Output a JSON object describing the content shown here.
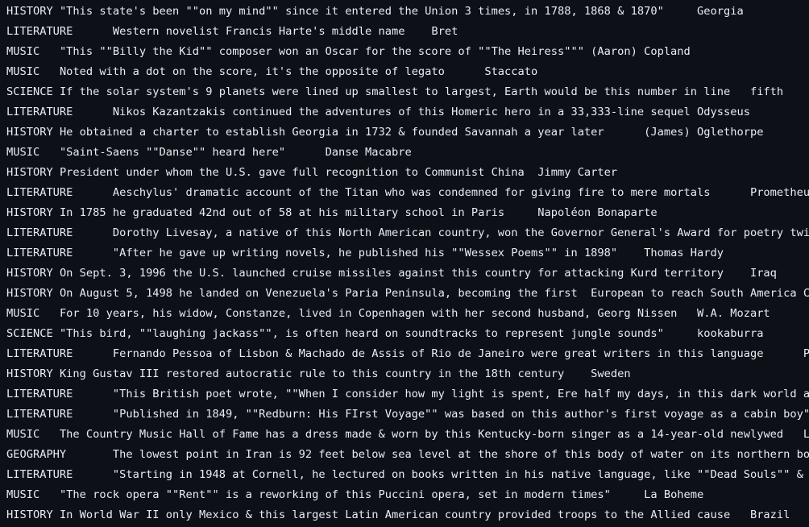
{
  "colors": {
    "background": "#0d1117",
    "text": "#e6edf3"
  },
  "rows": [
    {
      "category": "HISTORY",
      "question": "\"This state's been \"\"on my mind\"\" since it entered the Union 3 times, in 1788, 1868 & 1870\"",
      "answer": "Georgia"
    },
    {
      "category": "LITERATURE",
      "question": "Western novelist Francis Harte's middle name",
      "answer": "Bret"
    },
    {
      "category": "MUSIC",
      "question": "\"This \"\"Billy the Kid\"\" composer won an Oscar for the score of \"\"The Heiress\"\"\"",
      "answer": "(Aaron) Copland"
    },
    {
      "category": "MUSIC",
      "question": "Noted with a dot on the score, it's the opposite of legato",
      "answer": "Staccato"
    },
    {
      "category": "SCIENCE",
      "question": "If the solar system's 9 planets were lined up smallest to largest, Earth would be this number in line",
      "answer": "fifth"
    },
    {
      "category": "LITERATURE",
      "question": "Nikos Kazantzakis continued the adventures of this Homeric hero in a 33,333-line sequel",
      "answer": "Odysseus"
    },
    {
      "category": "HISTORY",
      "question": "He obtained a charter to establish Georgia in 1732 & founded Savannah a year later",
      "answer": "(James) Oglethorpe"
    },
    {
      "category": "MUSIC",
      "question": "\"Saint-Saens \"\"Danse\"\" heard here\"",
      "answer": "Danse Macabre"
    },
    {
      "category": "HISTORY",
      "question": "President under whom the U.S. gave full recognition to Communist China",
      "answer": "Jimmy Carter"
    },
    {
      "category": "LITERATURE",
      "question": "Aeschylus' dramatic account of the Titan who was condemned for giving fire to mere mortals",
      "answer": "Prometheu"
    },
    {
      "category": "HISTORY",
      "question": "In 1785 he graduated 42nd out of 58 at his military school in Paris",
      "answer": "Napoléon Bonaparte"
    },
    {
      "category": "LITERATURE",
      "question": "Dorothy Livesay, a native of this North American country, won the Governor General's Award for poetry twi",
      "answer": ""
    },
    {
      "category": "LITERATURE",
      "question": "\"After he gave up writing novels, he published his \"\"Wessex Poems\"\" in 1898\"",
      "answer": "Thomas Hardy"
    },
    {
      "category": "HISTORY",
      "question": "On Sept. 3, 1996 the U.S. launched cruise missiles against this country for attacking Kurd territory",
      "answer": "Iraq"
    },
    {
      "category": "HISTORY",
      "question": "On August 5, 1498 he landed on Venezuela's Paria Peninsula, becoming the first  European to reach South America",
      "answer": "C"
    },
    {
      "category": "MUSIC",
      "question": "For 10 years, his widow, Constanze, lived in Copenhagen with her second husband, Georg Nissen",
      "answer": "W.A. Mozart"
    },
    {
      "category": "SCIENCE",
      "question": "\"This bird, \"\"laughing jackass\"\", is often heard on soundtracks to represent jungle sounds\"",
      "answer": "kookaburra"
    },
    {
      "category": "LITERATURE",
      "question": "Fernando Pessoa of Lisbon & Machado de Assis of Rio de Janeiro were great writers in this language",
      "answer": "P"
    },
    {
      "category": "HISTORY",
      "question": "King Gustav III restored autocratic rule to this country in the 18th century",
      "answer": "Sweden"
    },
    {
      "category": "LITERATURE",
      "question": "\"This British poet wrote, \"\"When I consider how my light is spent, Ere half my days, in this dark world a",
      "answer": ""
    },
    {
      "category": "LITERATURE",
      "question": "\"Published in 1849, \"\"Redburn: His FIrst Voyage\"\" was based on this author's first voyage as a cabin boy\"",
      "answer": ""
    },
    {
      "category": "MUSIC",
      "question": "The Country Music Hall of Fame has a dress made & worn by this Kentucky-born singer as a 14-year-old newlywed",
      "answer": "L"
    },
    {
      "category": "GEOGRAPHY",
      "question": "The lowest point in Iran is 92 feet below sea level at the shore of this body of water on its northern bo",
      "answer": ""
    },
    {
      "category": "LITERATURE",
      "question": "\"Starting in 1948 at Cornell, he lectured on books written in his native language, like \"\"Dead Souls\"\" &",
      "answer": ""
    },
    {
      "category": "MUSIC",
      "question": "\"The rock opera \"\"Rent\"\" is a reworking of this Puccini opera, set in modern times\"",
      "answer": "La Boheme"
    },
    {
      "category": "HISTORY",
      "question": "In World War II only Mexico & this largest Latin American country provided troops to the Allied cause",
      "answer": "Brazil"
    }
  ]
}
